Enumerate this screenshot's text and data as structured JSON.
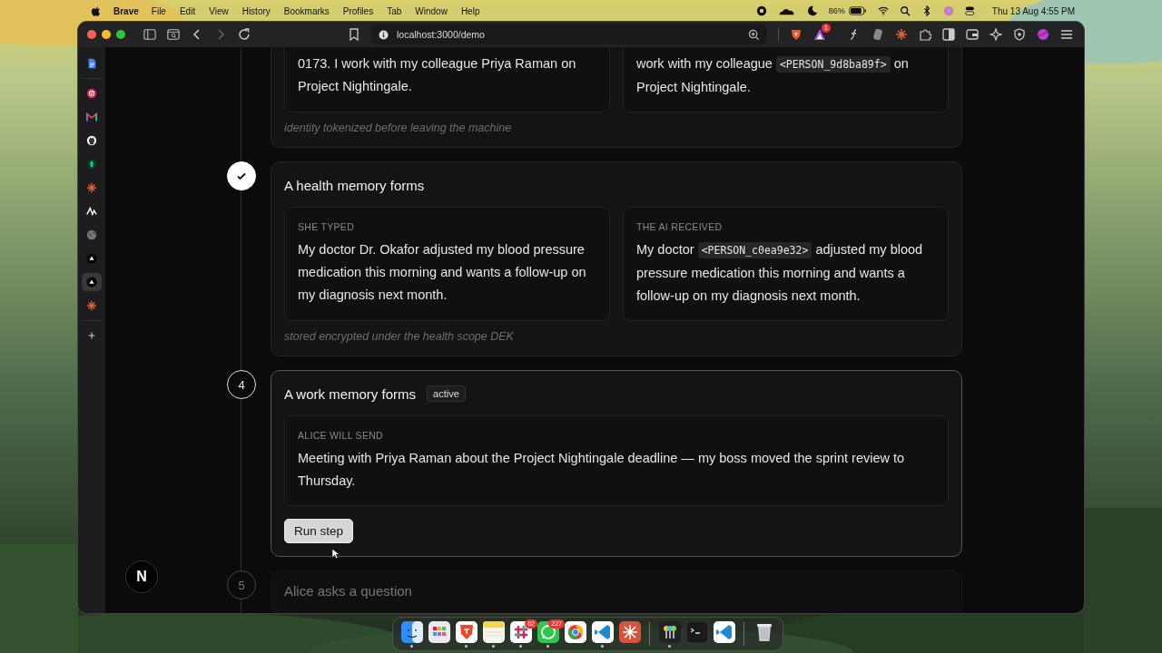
{
  "menu_bar": {
    "app": "Brave",
    "menus": [
      "File",
      "Edit",
      "View",
      "History",
      "Bookmarks",
      "Profiles",
      "Tab",
      "Window",
      "Help"
    ],
    "battery": "86%",
    "clock": "Thu 13 Aug  4:55 PM"
  },
  "browser": {
    "url": "localhost:3000/demo",
    "rewards_badge": "1"
  },
  "sidebar": {
    "items": [
      {
        "kind": "doc",
        "selected": false
      },
      {
        "kind": "target",
        "selected": false
      },
      {
        "kind": "mail",
        "selected": false
      },
      {
        "kind": "cat",
        "selected": false
      },
      {
        "kind": "leaf",
        "selected": false
      },
      {
        "kind": "burst",
        "selected": false
      },
      {
        "kind": "zigzag",
        "selected": false
      },
      {
        "kind": "globe",
        "selected": false
      },
      {
        "kind": "triangle",
        "selected": false
      },
      {
        "kind": "triangle",
        "selected": true
      },
      {
        "kind": "burst",
        "selected": false
      },
      {
        "kind": "plus",
        "selected": false
      }
    ]
  },
  "steps": [
    {
      "panels": [
        {
          "parts": [
            {
              "kind": "text",
              "text": "0173. I work with my colleague Priya Raman on Project Nightingale."
            }
          ]
        },
        {
          "parts": [
            {
              "kind": "text",
              "text": "work with my colleague "
            },
            {
              "kind": "code",
              "text": "<PERSON_9d8ba89f>"
            },
            {
              "kind": "text",
              "text": " on Project Nightingale."
            }
          ]
        }
      ],
      "note": "identity tokenized before leaving the machine"
    },
    {
      "completed": true,
      "active": false,
      "title": "A health memory forms",
      "panels": [
        {
          "label": "SHE TYPED",
          "parts": [
            {
              "kind": "text",
              "text": "My doctor Dr. Okafor adjusted my blood pressure medication this morning and wants a follow-up on my diagnosis next month."
            }
          ]
        },
        {
          "label": "THE AI RECEIVED",
          "parts": [
            {
              "kind": "text",
              "text": "My doctor "
            },
            {
              "kind": "code",
              "text": "<PERSON_c0ea9e32>"
            },
            {
              "kind": "text",
              "text": " adjusted my blood pressure medication this morning and wants a follow-up on my diagnosis next month."
            }
          ]
        }
      ],
      "note": "stored encrypted under the health scope DEK"
    },
    {
      "completed": false,
      "active": true,
      "number": "4",
      "title": "A work memory forms",
      "badge": "active",
      "panels": [
        {
          "label": "ALICE WILL SEND",
          "parts": [
            {
              "kind": "text",
              "text": "Meeting with Priya Raman about the Project Nightingale deadline — my boss moved the sprint review to Thursday."
            }
          ]
        }
      ],
      "button": "Run step"
    },
    {
      "completed": false,
      "active": false,
      "number": "5",
      "title": "Alice asks a question"
    }
  ],
  "dev_indicator": "N",
  "dock": {
    "apps": [
      {
        "kind": "face",
        "running": true
      },
      {
        "kind": "grid",
        "running": false
      },
      {
        "kind": "shield",
        "running": true
      },
      {
        "kind": "notepad",
        "running": true
      },
      {
        "kind": "hash",
        "badge": "62",
        "running": true
      },
      {
        "kind": "chat",
        "badge": "227",
        "running": true
      },
      {
        "kind": "ring",
        "running": false
      },
      {
        "kind": "ribbon",
        "running": true
      },
      {
        "kind": "burst",
        "running": false
      },
      {
        "kind": "separator"
      },
      {
        "kind": "keys",
        "running": true
      },
      {
        "kind": "terminal",
        "running": false
      },
      {
        "kind": "ribbon",
        "running": false
      },
      {
        "kind": "separator"
      },
      {
        "kind": "trash",
        "running": false
      }
    ]
  }
}
